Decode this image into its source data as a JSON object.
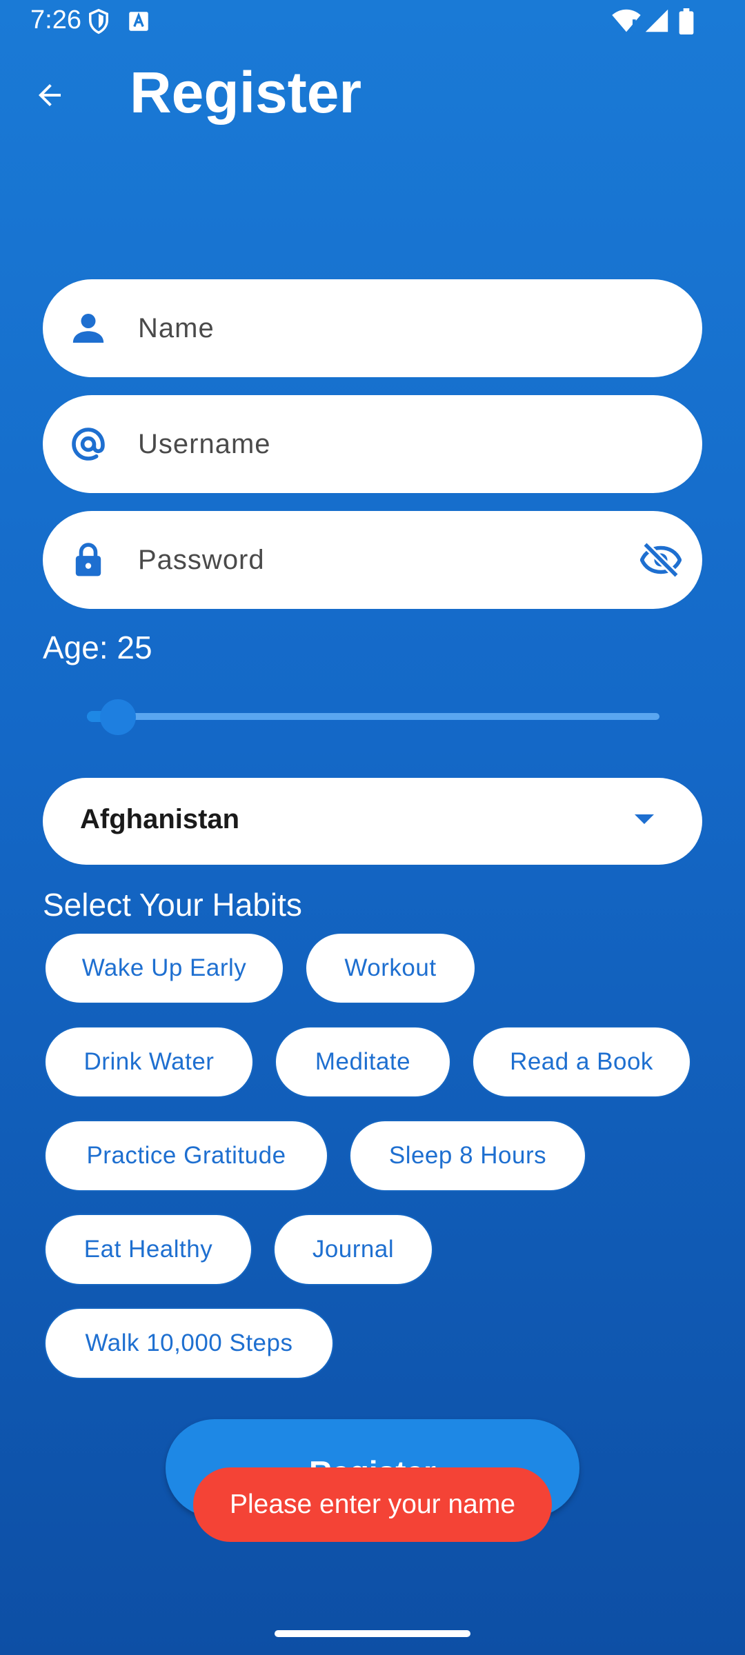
{
  "status_bar": {
    "time": "7:26"
  },
  "app_bar": {
    "title": "Register"
  },
  "form": {
    "name_placeholder": "Name",
    "username_placeholder": "Username",
    "password_placeholder": "Password",
    "age_label": "Age: 25",
    "age_slider_fraction": 0.054,
    "country": "Afghanistan",
    "habits_title": "Select Your Habits",
    "habits": [
      "Wake Up Early",
      "Workout",
      "Drink Water",
      "Meditate",
      "Read a Book",
      "Practice Gratitude",
      "Sleep 8 Hours",
      "Eat Healthy",
      "Journal",
      "Walk 10,000 Steps"
    ],
    "register_label": "Register"
  },
  "toast": {
    "message": "Please enter your name"
  },
  "colors": {
    "primary": "#1e88e5",
    "chip_text": "#1e6fd0",
    "toast": "#f44336"
  }
}
